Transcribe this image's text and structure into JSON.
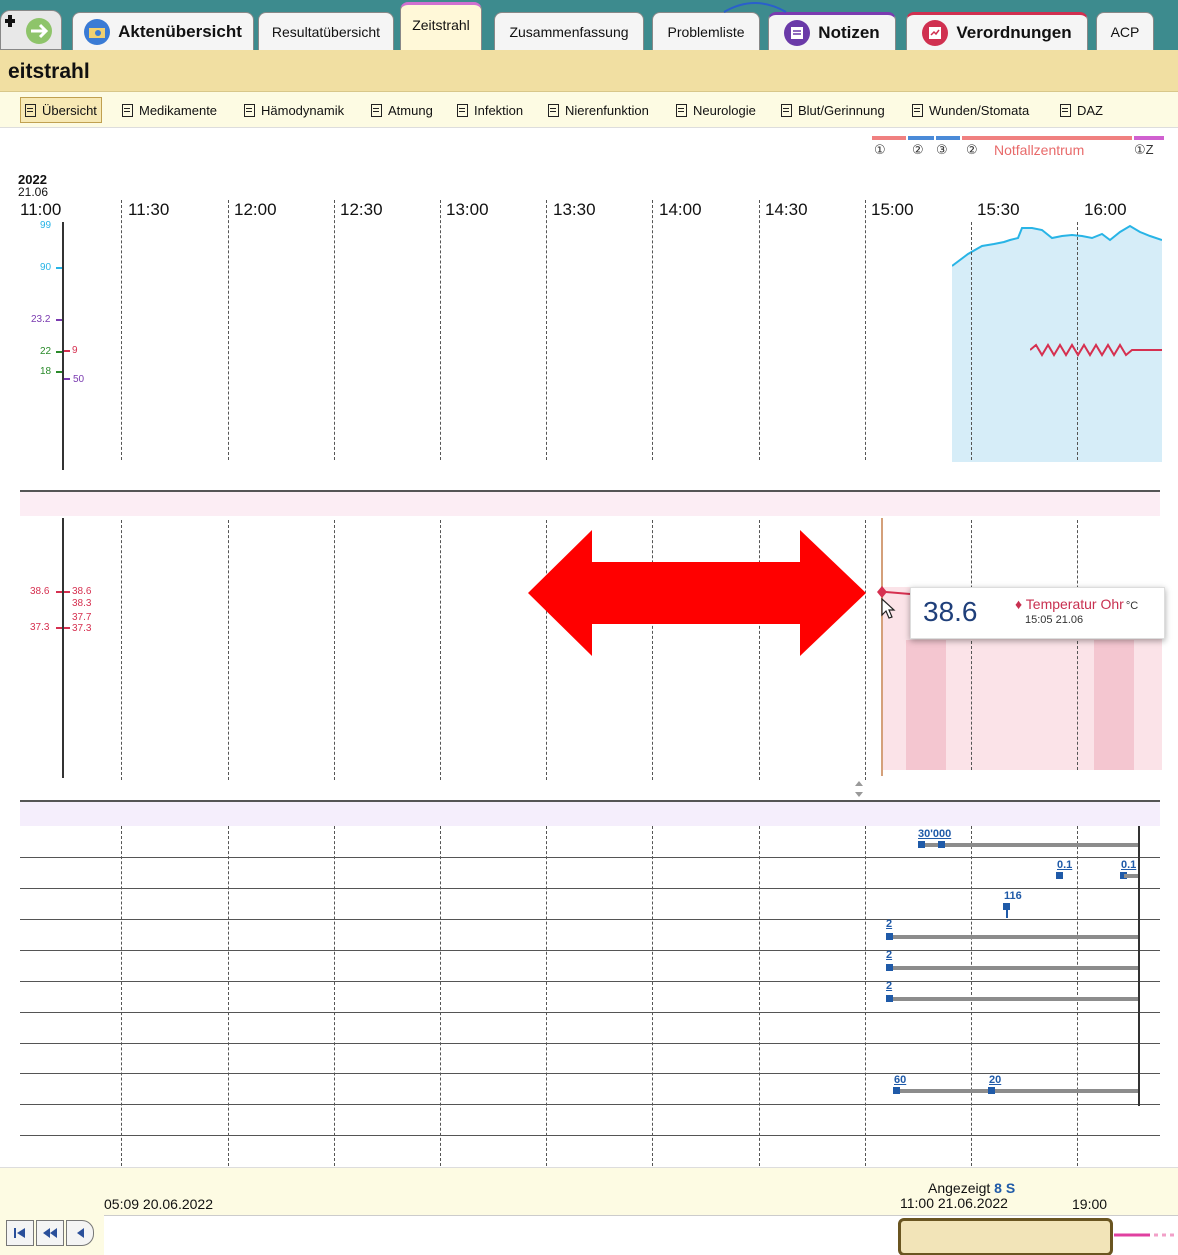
{
  "tabs": {
    "aktenuebersicht": "Aktenübersicht",
    "resultatuebersicht": "Resultatübersicht",
    "zeitstrahl": "Zeitstrahl",
    "zusammenfassung": "Zusammenfassung",
    "problemliste": "Problemliste",
    "notizen": "Notizen",
    "verordnungen": "Verordnungen",
    "acp": "ACP"
  },
  "page_title": "eitstrahl",
  "subtabs": {
    "uebersicht": "Übersicht",
    "medikamente": "Medikamente",
    "haemodynamik": "Hämodynamik",
    "atmung": "Atmung",
    "infektion": "Infektion",
    "nierenfunktion": "Nierenfunktion",
    "neurologie": "Neurologie",
    "blut": "Blut/Gerinnung",
    "wunden": "Wunden/Stomata",
    "daz": "DAZ"
  },
  "timeline": {
    "year": "2022",
    "day": "21.06",
    "ticks": [
      "11:00",
      "11:30",
      "12:00",
      "12:30",
      "13:00",
      "13:30",
      "14:00",
      "14:30",
      "15:00",
      "15:30",
      "16:00"
    ],
    "location_markers": [
      "①",
      "②",
      "③",
      "②"
    ],
    "location_label": "Notfallzentrum",
    "location_marker_right": "①Z"
  },
  "vitals_axis": {
    "spo2_upper": "99",
    "spo2_90": "90",
    "v23_2": "23.2",
    "v22": "22",
    "v9": "9",
    "v18": "18",
    "v50": "50"
  },
  "temp_axis": {
    "left_upper": "38.6",
    "left_lower": "37.3",
    "right_1": "38.6",
    "right_2": "38.3",
    "right_3": "37.7",
    "right_4": "37.3"
  },
  "tooltip": {
    "value": "38.6",
    "name": "Temperatur Ohr",
    "unit": "°C",
    "time": "15:05 21.06"
  },
  "bar_labels": {
    "l30000": "30'000",
    "l01a": "0.1",
    "l01b": "0.1",
    "l116": "116",
    "l2a": "2",
    "l2b": "2",
    "l2c": "2",
    "l60": "60",
    "l20": "20"
  },
  "navigator": {
    "start": "05:09 20.06.2022",
    "angezeigt_label": "Angezeigt",
    "angezeigt_value": "8 S",
    "view_start": "11:00 21.06.2022",
    "view_end": "19:00",
    "btn_first": "◀◀",
    "btn_prev_fast": "◀◀",
    "btn_prev": "◀"
  },
  "colors": {
    "tabbar": "#3d8b8e",
    "accent_spo2": "#28b4e6",
    "accent_temp": "#d63050",
    "annotation_arrow": "#ff0000",
    "bar_marker": "#1f5aa8"
  }
}
